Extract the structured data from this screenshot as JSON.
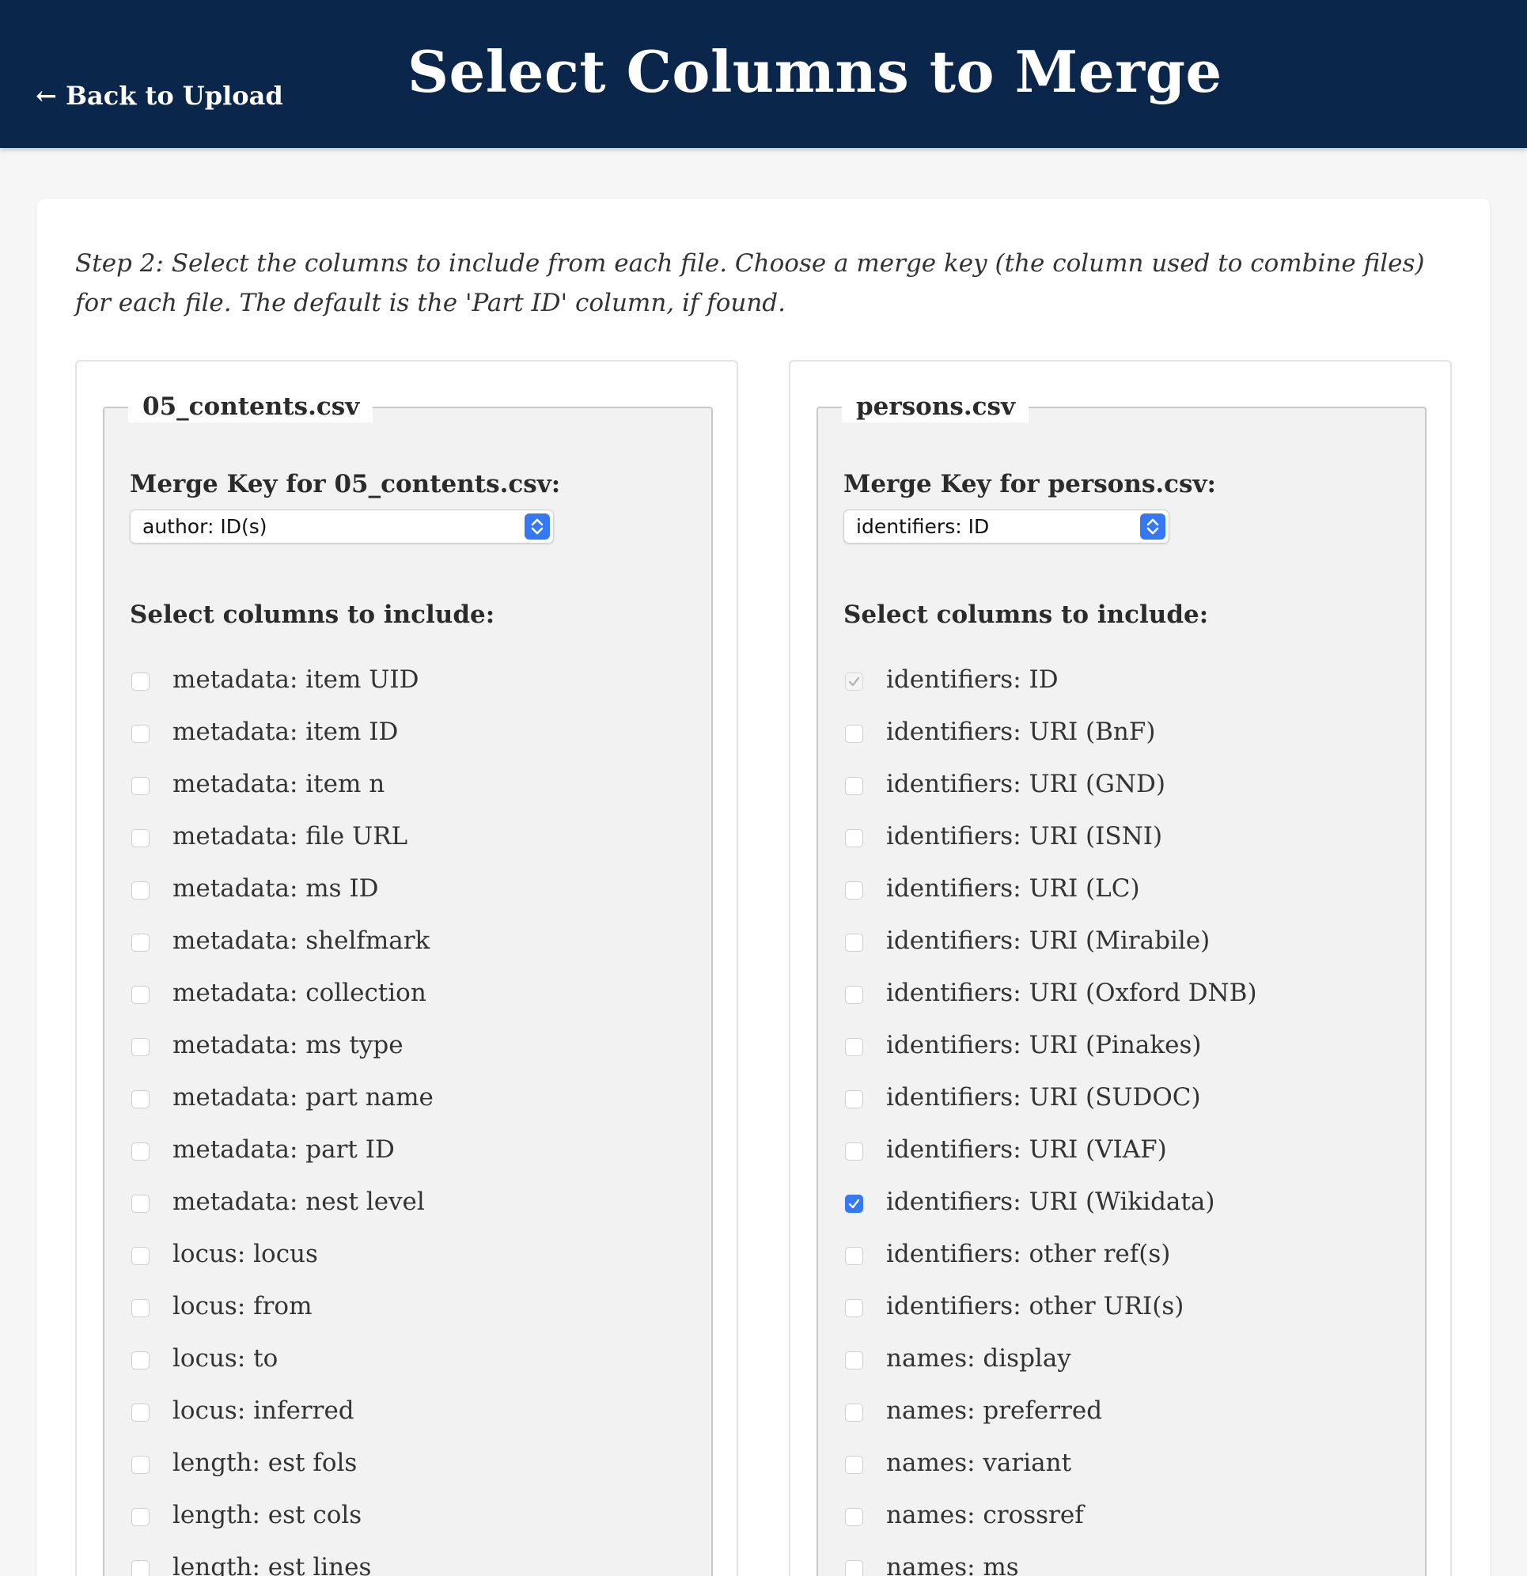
{
  "header": {
    "back_link": "← Back to Upload",
    "title": "Select Columns to Merge"
  },
  "instructions": "Step 2: Select the columns to include from each file. Choose a merge key (the column used to combine files) for each file. The default is the 'Part ID' column, if found.",
  "colors": {
    "header_bg": "#0b264b",
    "checkbox_checked": "#3478f6"
  },
  "files": [
    {
      "legend": "05_contents.csv",
      "merge_key_label": "Merge Key for 05_contents.csv:",
      "merge_key_value": "author: ID(s)",
      "include_label": "Select columns to include:",
      "columns": [
        {
          "label": "metadata: item UID",
          "checked": false,
          "disabled": false
        },
        {
          "label": "metadata: item ID",
          "checked": false,
          "disabled": false
        },
        {
          "label": "metadata: item n",
          "checked": false,
          "disabled": false
        },
        {
          "label": "metadata: file URL",
          "checked": false,
          "disabled": false
        },
        {
          "label": "metadata: ms ID",
          "checked": false,
          "disabled": false
        },
        {
          "label": "metadata: shelfmark",
          "checked": false,
          "disabled": false
        },
        {
          "label": "metadata: collection",
          "checked": false,
          "disabled": false
        },
        {
          "label": "metadata: ms type",
          "checked": false,
          "disabled": false
        },
        {
          "label": "metadata: part name",
          "checked": false,
          "disabled": false
        },
        {
          "label": "metadata: part ID",
          "checked": false,
          "disabled": false
        },
        {
          "label": "metadata: nest level",
          "checked": false,
          "disabled": false
        },
        {
          "label": "locus: locus",
          "checked": false,
          "disabled": false
        },
        {
          "label": "locus: from",
          "checked": false,
          "disabled": false
        },
        {
          "label": "locus: to",
          "checked": false,
          "disabled": false
        },
        {
          "label": "locus: inferred",
          "checked": false,
          "disabled": false
        },
        {
          "label": "length: est fols",
          "checked": false,
          "disabled": false
        },
        {
          "label": "length: est cols",
          "checked": false,
          "disabled": false
        },
        {
          "label": "length: est lines",
          "checked": false,
          "disabled": false
        }
      ]
    },
    {
      "legend": "persons.csv",
      "merge_key_label": "Merge Key for persons.csv:",
      "merge_key_value": "identifiers: ID",
      "include_label": "Select columns to include:",
      "columns": [
        {
          "label": "identifiers: ID",
          "checked": true,
          "disabled": true
        },
        {
          "label": "identifiers: URI (BnF)",
          "checked": false,
          "disabled": false
        },
        {
          "label": "identifiers: URI (GND)",
          "checked": false,
          "disabled": false
        },
        {
          "label": "identifiers: URI (ISNI)",
          "checked": false,
          "disabled": false
        },
        {
          "label": "identifiers: URI (LC)",
          "checked": false,
          "disabled": false
        },
        {
          "label": "identifiers: URI (Mirabile)",
          "checked": false,
          "disabled": false
        },
        {
          "label": "identifiers: URI (Oxford DNB)",
          "checked": false,
          "disabled": false
        },
        {
          "label": "identifiers: URI (Pinakes)",
          "checked": false,
          "disabled": false
        },
        {
          "label": "identifiers: URI (SUDOC)",
          "checked": false,
          "disabled": false
        },
        {
          "label": "identifiers: URI (VIAF)",
          "checked": false,
          "disabled": false
        },
        {
          "label": "identifiers: URI (Wikidata)",
          "checked": true,
          "disabled": false
        },
        {
          "label": "identifiers: other ref(s)",
          "checked": false,
          "disabled": false
        },
        {
          "label": "identifiers: other URI(s)",
          "checked": false,
          "disabled": false
        },
        {
          "label": "names: display",
          "checked": false,
          "disabled": false
        },
        {
          "label": "names: preferred",
          "checked": false,
          "disabled": false
        },
        {
          "label": "names: variant",
          "checked": false,
          "disabled": false
        },
        {
          "label": "names: crossref",
          "checked": false,
          "disabled": false
        },
        {
          "label": "names: ms",
          "checked": false,
          "disabled": false
        }
      ]
    }
  ]
}
